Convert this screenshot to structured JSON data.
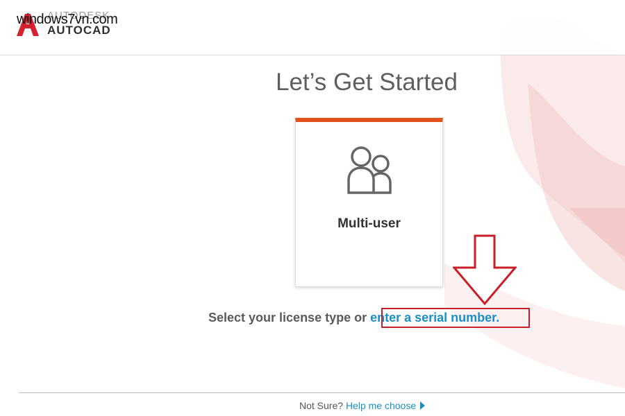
{
  "header": {
    "brand": "AUTODESK",
    "product": "AUTOCAD",
    "watermark": "windows7vn.com"
  },
  "main": {
    "title": "Let’s Get Started",
    "card": {
      "label": "Multi-user",
      "icon": "users-icon",
      "accent": "#e2521d"
    },
    "prompt": "Select your license type or ",
    "serial_link": "enter a serial number",
    "serial_suffix": "."
  },
  "footer": {
    "question": "Not Sure? ",
    "help_link": "Help me choose"
  },
  "colors": {
    "link": "#1a8fc6",
    "annotation": "#c81e2a",
    "brand_red": "#d3212f"
  }
}
